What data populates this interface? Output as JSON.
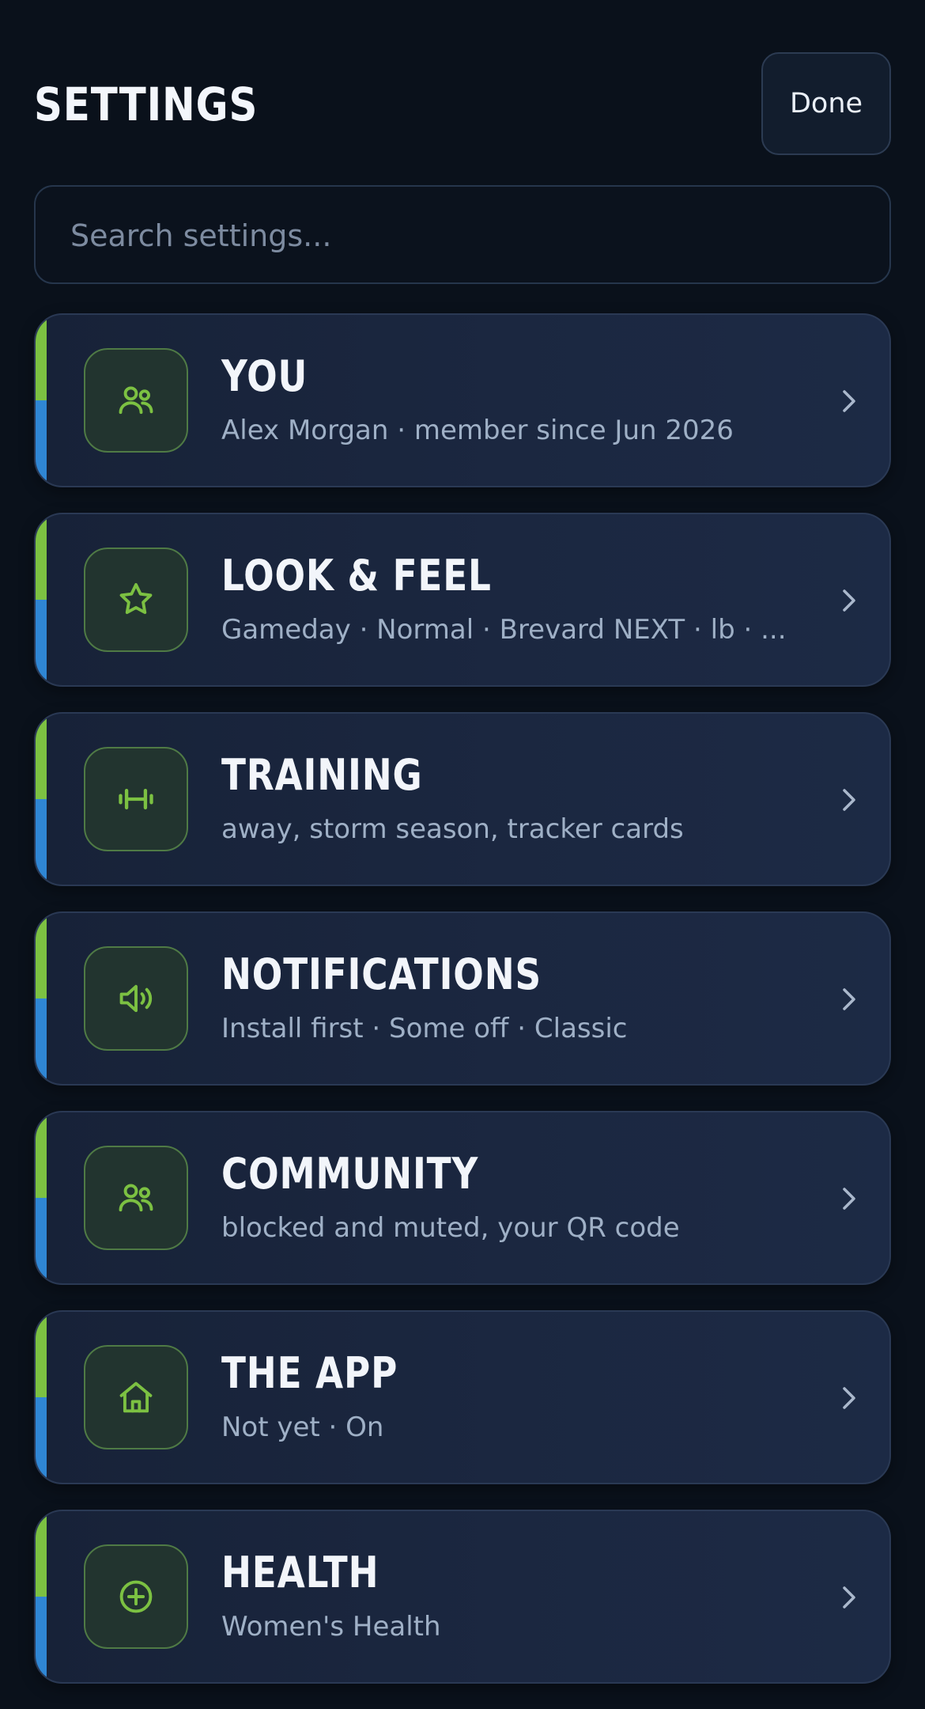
{
  "header": {
    "title": "SETTINGS",
    "done_label": "Done"
  },
  "search": {
    "placeholder": "Search settings...",
    "value": ""
  },
  "colors": {
    "background": "#0a111b",
    "card": "#1b2740",
    "accent_green": "#7cc142",
    "accent_blue": "#2f86d4",
    "subtitle": "#9fb0c6"
  },
  "sections": [
    {
      "id": "you",
      "icon": "people-icon",
      "title": "YOU",
      "subtitle": "Alex Morgan · member since Jun 2026"
    },
    {
      "id": "look-feel",
      "icon": "star-icon",
      "title": "LOOK & FEEL",
      "subtitle": "Gameday · Normal · Brevard NEXT · lb · ..."
    },
    {
      "id": "training",
      "icon": "dumbbell-icon",
      "title": "TRAINING",
      "subtitle": "away, storm season, tracker cards"
    },
    {
      "id": "notifications",
      "icon": "speaker-icon",
      "title": "NOTIFICATIONS",
      "subtitle": "Install first · Some off · Classic"
    },
    {
      "id": "community",
      "icon": "people-icon",
      "title": "COMMUNITY",
      "subtitle": "blocked and muted, your QR code"
    },
    {
      "id": "the-app",
      "icon": "home-icon",
      "title": "THE APP",
      "subtitle": "Not yet · On"
    },
    {
      "id": "health",
      "icon": "plus-circle-icon",
      "title": "HEALTH",
      "subtitle": "Women's Health"
    }
  ]
}
